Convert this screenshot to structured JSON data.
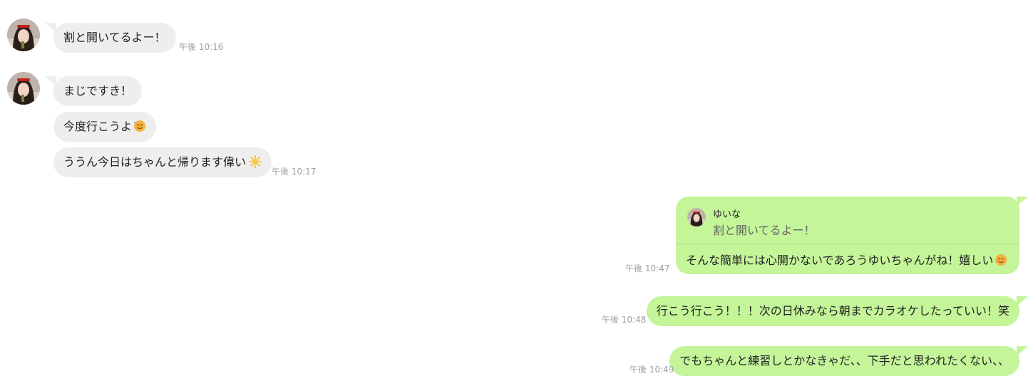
{
  "messages": {
    "m1": {
      "text": "割と開いてるよー！",
      "time": "午後 10:16"
    },
    "m2": {
      "text": "まじですき！"
    },
    "m3": {
      "text": "今度行こうよ"
    },
    "m4": {
      "text": "ううん今日はちゃんと帰ります偉い",
      "time": "午後 10:17"
    },
    "m5": {
      "quote_name": "ゆいな",
      "quote_text": "割と開いてるよー！",
      "text": "そんな簡単には心開かないであろうゆいちゃんがね！嬉しい",
      "time": "午後 10:47"
    },
    "m6": {
      "text": "行こう行こう！！！次の日休みなら朝までカラオケしたっていい！笑",
      "time": "午後 10:48"
    },
    "m7": {
      "text": "でもちゃんと練習しとかなきゃだ、、下手だと思われたくない、、",
      "time": "午後 10:49"
    }
  },
  "colors": {
    "incoming_bubble": "#eeeeee",
    "outgoing_bubble": "#c4f599",
    "timestamp": "#a0a0a0"
  },
  "icons": {
    "sweat_face": "grinning-face-with-sweat-emoji",
    "sun": "sun-emoji",
    "smile": "smiling-face-emoji"
  }
}
